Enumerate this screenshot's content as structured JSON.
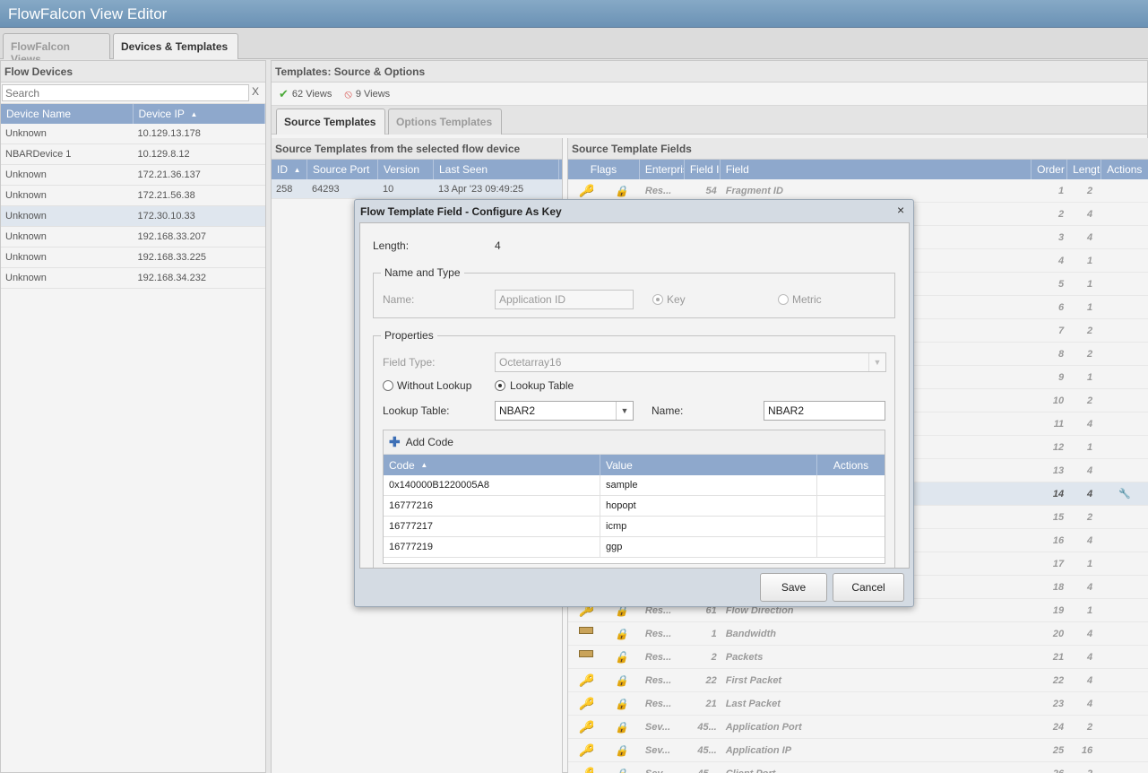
{
  "app": {
    "title": "FlowFalcon View Editor"
  },
  "tabs": [
    {
      "label": "FlowFalcon Views"
    },
    {
      "label": "Devices & Templates"
    }
  ],
  "devices": {
    "title": "Flow Devices",
    "search_placeholder": "Search",
    "clear_label": "X",
    "columns": [
      "Device Name",
      "Device IP"
    ],
    "rows": [
      {
        "name": "Unknown",
        "ip": "10.129.13.178"
      },
      {
        "name": "NBARDevice 1",
        "ip": "10.129.8.12"
      },
      {
        "name": "Unknown",
        "ip": "172.21.36.137"
      },
      {
        "name": "Unknown",
        "ip": "172.21.56.38"
      },
      {
        "name": "Unknown",
        "ip": "172.30.10.33"
      },
      {
        "name": "Unknown",
        "ip": "192.168.33.207"
      },
      {
        "name": "Unknown",
        "ip": "192.168.33.225"
      },
      {
        "name": "Unknown",
        "ip": "192.168.34.232"
      }
    ]
  },
  "templates": {
    "title": "Templates: Source & Options",
    "views_ok": "62 Views",
    "views_bad": "9 Views",
    "subtabs": [
      {
        "label": "Source Templates"
      },
      {
        "label": "Options Templates"
      }
    ],
    "source_title": "Source Templates from the selected flow device",
    "source_columns": [
      "ID",
      "Source Port",
      "Version",
      "Last Seen"
    ],
    "source_rows": [
      {
        "id": "258",
        "port": "64293",
        "version": "10",
        "last_seen": "13 Apr '23 09:49:25"
      }
    ]
  },
  "fields": {
    "title": "Source Template Fields",
    "columns": [
      "Flags",
      "Enterpris",
      "Field II",
      "Field",
      "Order",
      "Length",
      "Actions"
    ],
    "rows": [
      {
        "icon": "key",
        "lock": "lock",
        "ent": "Res...",
        "fid": "54",
        "name": "Fragment ID",
        "order": "1",
        "len": "2"
      },
      {
        "order": "2",
        "len": "4"
      },
      {
        "order": "3",
        "len": "4"
      },
      {
        "order": "4",
        "len": "1"
      },
      {
        "order": "5",
        "len": "1"
      },
      {
        "order": "6",
        "len": "1"
      },
      {
        "order": "7",
        "len": "2"
      },
      {
        "order": "8",
        "len": "2"
      },
      {
        "order": "9",
        "len": "1"
      },
      {
        "order": "10",
        "len": "2"
      },
      {
        "order": "11",
        "len": "4"
      },
      {
        "order": "12",
        "len": "1"
      },
      {
        "order": "13",
        "len": "4"
      },
      {
        "order": "14",
        "len": "4"
      },
      {
        "order": "15",
        "len": "2"
      },
      {
        "order": "16",
        "len": "4"
      },
      {
        "order": "17",
        "len": "1"
      },
      {
        "order": "18",
        "len": "4"
      },
      {
        "icon": "key",
        "lock": "lock",
        "ent": "Res...",
        "fid": "61",
        "name": "Flow Direction",
        "order": "19",
        "len": "1"
      },
      {
        "icon": "ruler",
        "lock": "lock",
        "ent": "Res...",
        "fid": "1",
        "name": "Bandwidth",
        "order": "20",
        "len": "4"
      },
      {
        "icon": "ruler",
        "lock": "unlock",
        "ent": "Res...",
        "fid": "2",
        "name": "Packets",
        "order": "21",
        "len": "4"
      },
      {
        "icon": "key",
        "lock": "lock",
        "ent": "Res...",
        "fid": "22",
        "name": "First Packet",
        "order": "22",
        "len": "4"
      },
      {
        "icon": "key",
        "lock": "lock",
        "ent": "Res...",
        "fid": "21",
        "name": "Last Packet",
        "order": "23",
        "len": "4"
      },
      {
        "icon": "key",
        "lock": "lock",
        "ent": "Sev...",
        "fid": "45...",
        "name": "Application Port",
        "order": "24",
        "len": "2"
      },
      {
        "icon": "key",
        "lock": "lock",
        "ent": "Sev...",
        "fid": "45...",
        "name": "Application IP",
        "order": "25",
        "len": "16"
      },
      {
        "icon": "key",
        "lock": "lock",
        "ent": "Sev...",
        "fid": "45...",
        "name": "Client Port",
        "order": "26",
        "len": "2"
      }
    ]
  },
  "dialog": {
    "title": "Flow Template Field - Configure As Key",
    "close": "×",
    "length_label": "Length:",
    "length_value": "4",
    "name_type_legend": "Name and Type",
    "name_label": "Name:",
    "name_value": "Application ID",
    "key_label": "Key",
    "metric_label": "Metric",
    "props_legend": "Properties",
    "field_type_label": "Field Type:",
    "field_type_value": "Octetarray16",
    "without_lookup": "Without Lookup",
    "lookup_table_opt": "Lookup Table",
    "lookup_table_label": "Lookup Table:",
    "lookup_table_value": "NBAR2",
    "lookup_name_label": "Name:",
    "lookup_name_value": "NBAR2",
    "add_code": "Add Code",
    "code_columns": [
      "Code",
      "Value",
      "Actions"
    ],
    "codes": [
      {
        "code": "0x140000B1220005A8",
        "value": "sample"
      },
      {
        "code": "16777216",
        "value": "hopopt"
      },
      {
        "code": "16777217",
        "value": "icmp"
      },
      {
        "code": "16777219",
        "value": "ggp"
      }
    ],
    "save": "Save",
    "cancel": "Cancel"
  }
}
